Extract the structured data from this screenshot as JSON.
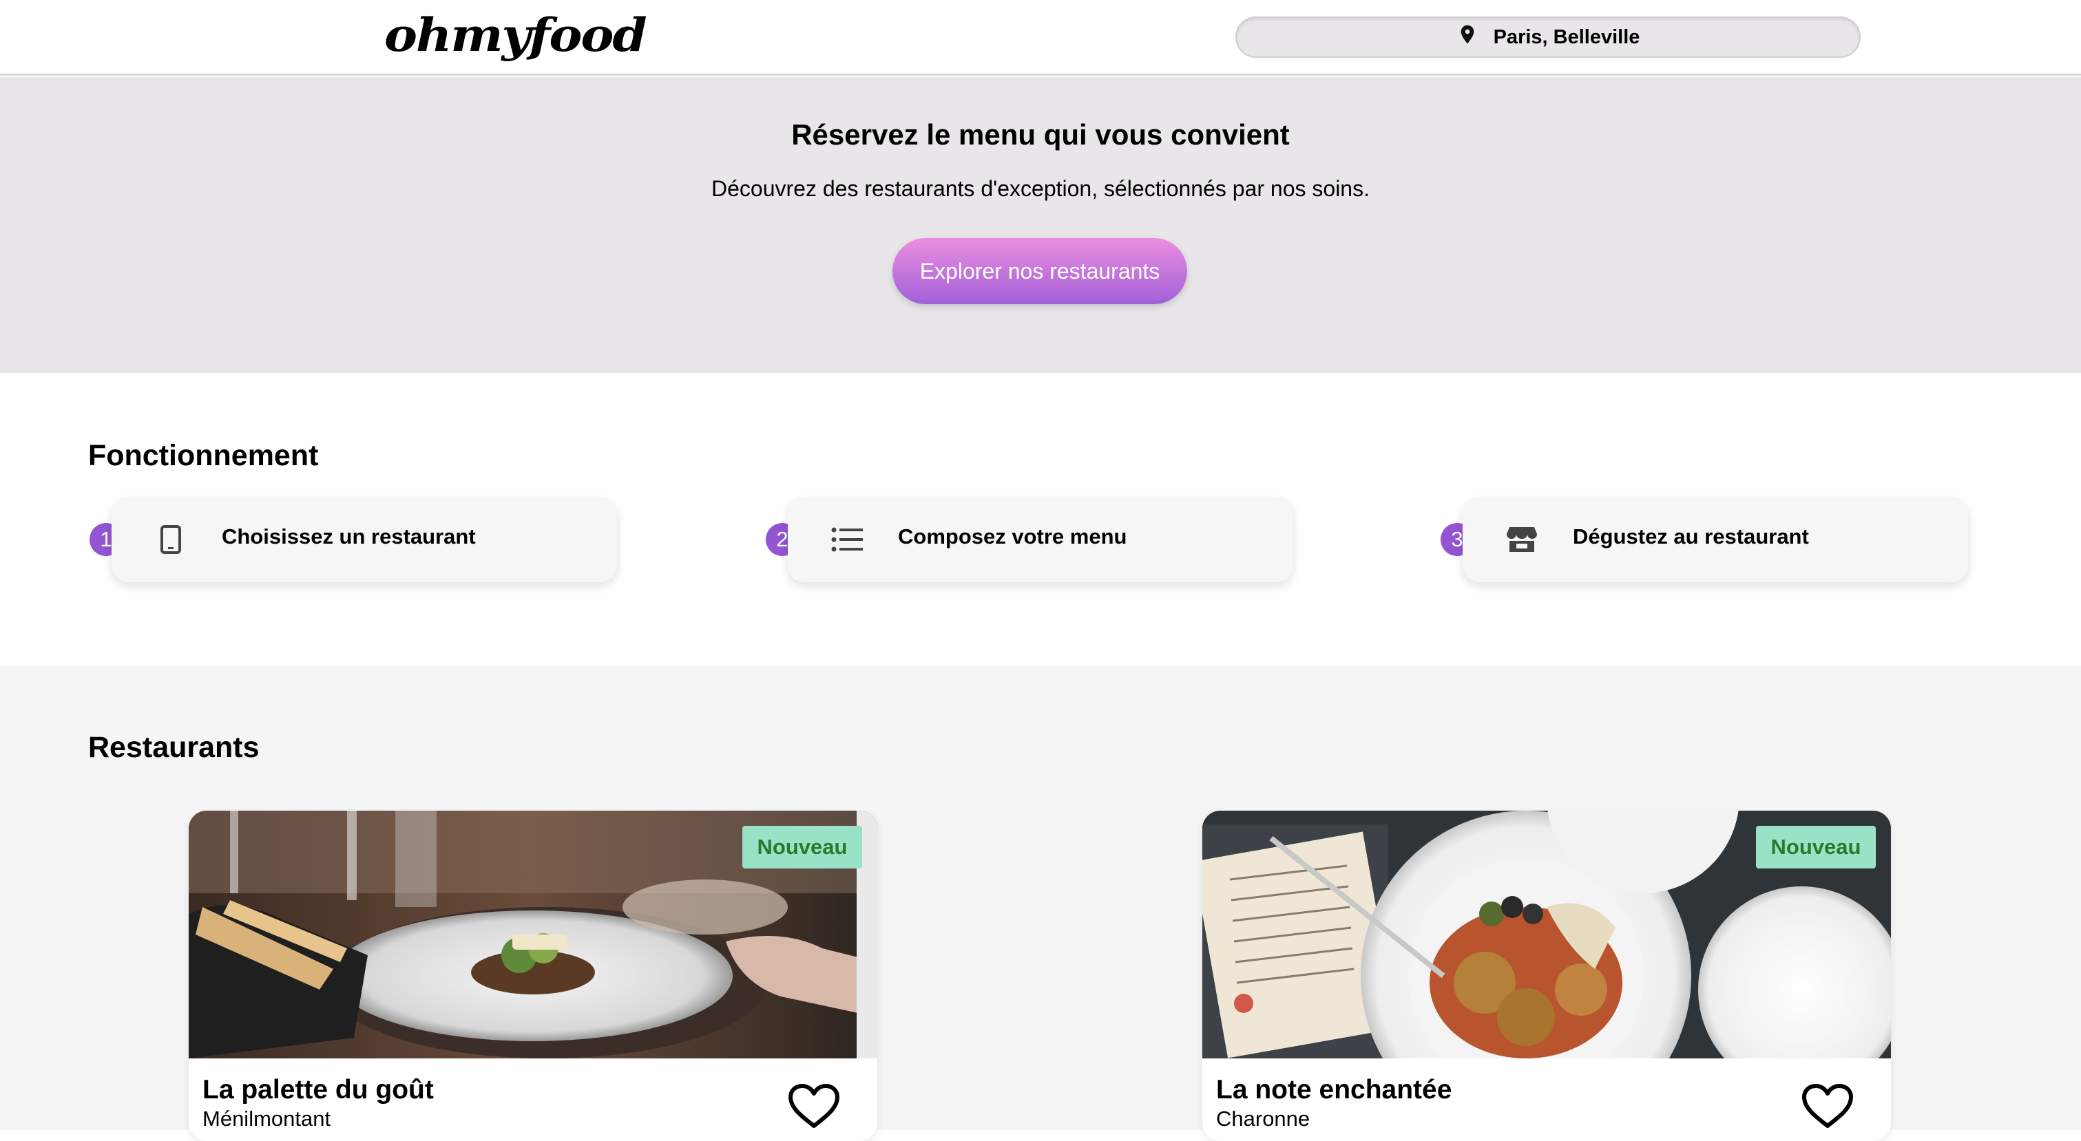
{
  "header": {
    "logo": "ohmyfood",
    "location": "Paris, Belleville",
    "location_icon": "map-pin-icon"
  },
  "hero": {
    "title": "Réservez le menu qui vous convient",
    "subtitle": "Découvrez des restaurants d'exception, sélectionnés par nos soins.",
    "button": "Explorer nos restaurants"
  },
  "how_it_works": {
    "title": "Fonctionnement",
    "steps": [
      {
        "number": "1",
        "icon": "smartphone-icon",
        "label": "Choisissez un restaurant"
      },
      {
        "number": "2",
        "icon": "list-icon",
        "label": "Composez votre menu"
      },
      {
        "number": "3",
        "icon": "store-icon",
        "label": "Dégustez au restaurant"
      }
    ]
  },
  "restaurants": {
    "title": "Restaurants",
    "items": [
      {
        "badge": "Nouveau",
        "name": "La palette du goût",
        "location": "Ménilmontant",
        "favorite_icon": "heart-icon"
      },
      {
        "badge": "Nouveau",
        "name": "La note enchantée",
        "location": "Charonne",
        "favorite_icon": "heart-icon"
      }
    ]
  },
  "colors": {
    "accent": "#9355d3",
    "gradient_top": "#eb8ee0",
    "gradient_bottom": "#a260d8",
    "badge_bg": "#99e2c8",
    "badge_text": "#2b7a2b"
  }
}
